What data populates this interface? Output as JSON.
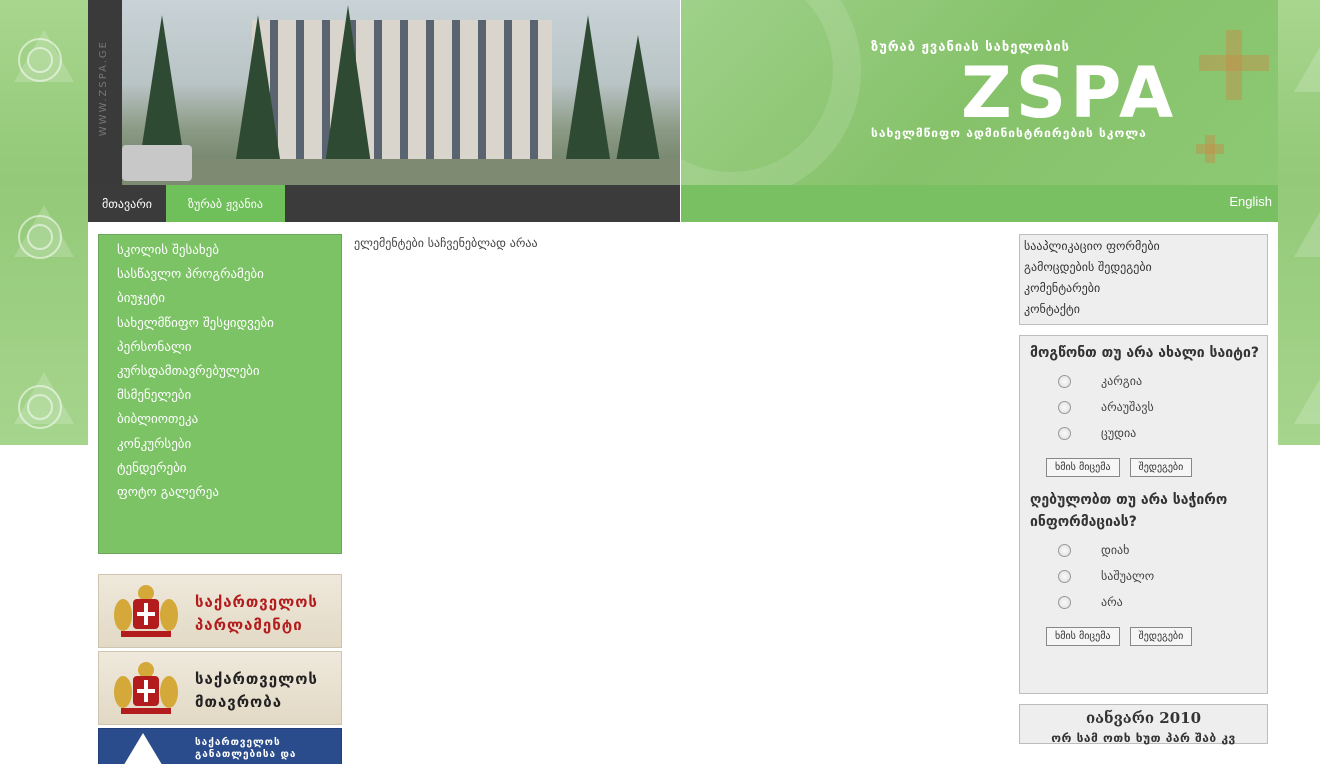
{
  "header": {
    "vertical_text": "WWW.ZSPA.GE",
    "brand_top": "ზურაბ ჟვანიას სახელობის",
    "brand_logo": "ZSPA",
    "brand_bottom": "სახელმწიფო ადმინისტრირების სკოლა"
  },
  "nav": {
    "items": [
      "მთავარი",
      "ზურაბ ჟვანია"
    ],
    "active_index": 1,
    "english_label": "English"
  },
  "left_menu": {
    "items": [
      "სკოლის შესახებ",
      "სასწავლო პროგრამები",
      "ბიუჯეტი",
      "სახელმწიფო შესყიდვები",
      "პერსონალი",
      "კურსდამთავრებულები",
      "მსმენელები",
      "ბიბლიოთეკა",
      "კონკურსები",
      "ტენდერები",
      "ფოტო გალერეა"
    ]
  },
  "banners": [
    {
      "line1": "საქართველოს",
      "line2": "პარლამენტი"
    },
    {
      "line1": "საქართველოს",
      "line2": "მთავრობა"
    },
    {
      "line1": "საქართველოს",
      "line2": "განათლებისა და"
    }
  ],
  "main": {
    "message": "ელემენტები საჩვენებლად არაა"
  },
  "right_links": [
    "სააპლიკაციო ფორმები",
    "გამოცდების შედეგები",
    "კომენტარები",
    "კონტაქტი"
  ],
  "polls": [
    {
      "question": "მოგწონთ თუ არა ახალი საიტი?",
      "options": [
        "კარგია",
        "არაუშავს",
        "ცუდია"
      ],
      "vote_label": "ხმის მიცემა",
      "results_label": "შედეგები"
    },
    {
      "question": "ღებულობთ თუ არა საჭირო ინფორმაციას?",
      "options": [
        "დიახ",
        "საშუალო",
        "არა"
      ],
      "vote_label": "ხმის მიცემა",
      "results_label": "შედეგები"
    }
  ],
  "calendar": {
    "title": "იანვარი 2010",
    "weekdays": "ორ სამ ოთხ ხუთ პარ შაბ კვ"
  },
  "colors": {
    "green_bg": "#93c978",
    "menu_green": "#7cc366",
    "nav_dark": "#3b3b3b",
    "nav_active": "#6fbf5a"
  }
}
